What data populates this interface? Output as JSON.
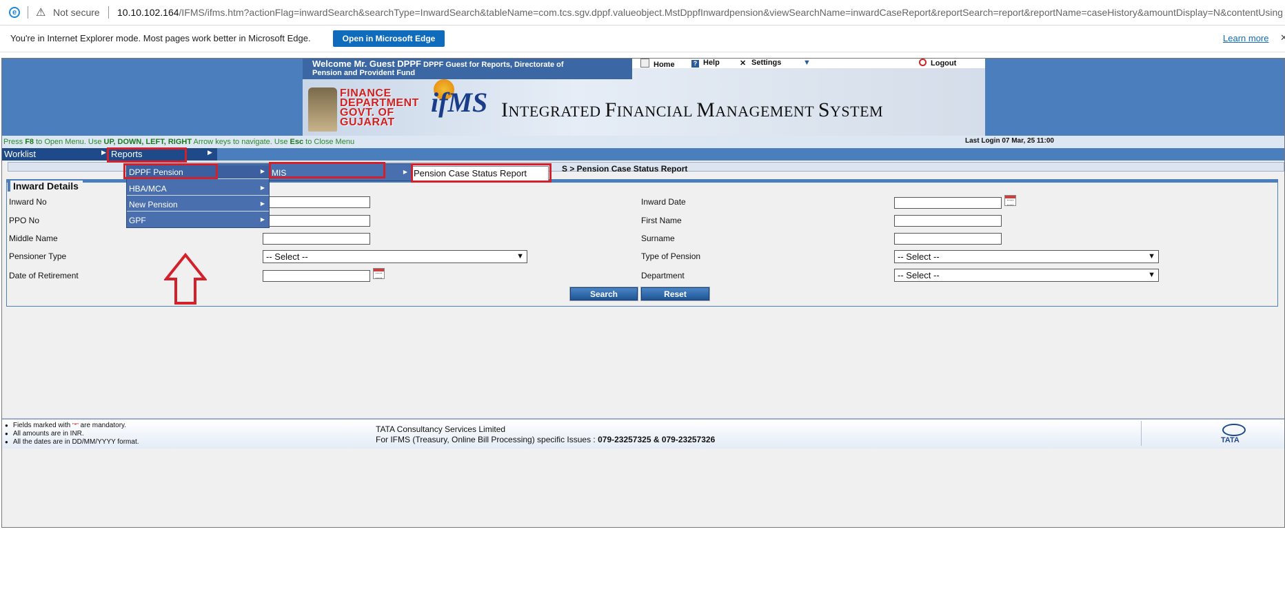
{
  "browser": {
    "security": "Not secure",
    "url_host": "10.10.102.164",
    "url_rest": "/IFMS/ifms.htm?actionFlag=inwardSearch&searchType=InwardSearch&tableName=com.tcs.sgv.dppf.valueobject.MstDppfInwardpension&viewSearchName=inwardCaseReport&reportSearch=report&reportName=caseHistory&amountDisplay=N&contentUsingA",
    "ie_message": "You're in Internet Explorer mode. Most pages work better in Microsoft Edge.",
    "open_edge": "Open in Microsoft Edge",
    "learn_more": "Learn more"
  },
  "header": {
    "welcome": "Welcome Mr. Guest  DPPF",
    "welcome_sub": "DPPF Guest for Reports, Directorate of",
    "welcome_sub2": "Pension and Provident Fund",
    "links": {
      "home": "Home",
      "help": "Help",
      "settings": "Settings",
      "logout": "Logout"
    },
    "dept": [
      "FINANCE",
      "DEPARTMENT",
      "GOVT. OF",
      "GUJARAT"
    ],
    "logo_text": "ifMS",
    "system_name_parts": [
      "I",
      "NTEGRATED ",
      "F",
      "INANCIAL ",
      "M",
      "ANAGEMENT ",
      "S",
      "YSTEM"
    ]
  },
  "hint": {
    "p1": "Press ",
    "k1": "F8",
    "p2": " to Open Menu. Use ",
    "k2": "UP, DOWN, LEFT, RIGHT",
    "p3": " Arrow keys to navigate. Use ",
    "k3": "Esc",
    "p4": " to Close Menu",
    "last_login": "Last Login 07 Mar, 25 11:00"
  },
  "menubar": {
    "worklist": "Worklist",
    "reports": "Reports"
  },
  "menus": {
    "reports_items": [
      "DPPF Pension",
      "HBA/MCA",
      "New Pension",
      "GPF"
    ],
    "dppf_items": [
      "MIS"
    ],
    "mis_items": [
      "Pension Case Status Report"
    ]
  },
  "breadcrumb": "S  > Pension Case Status Report",
  "form": {
    "title": "Inward Details",
    "inward_no": "Inward No",
    "inward_date": "Inward Date",
    "ppo_no": "PPO No",
    "first_name": "First Name",
    "middle_name": "Middle Name",
    "surname": "Surname",
    "pensioner_type": "Pensioner Type",
    "type_of_pension": "Type of Pension",
    "date_of_retirement": "Date of Retirement",
    "department": "Department",
    "select_placeholder": "-- Select --",
    "search": "Search",
    "reset": "Reset"
  },
  "footer": {
    "note1a": "Fields marked with ",
    "mandatory_mark": "\"*\"",
    "note1b": " are mandatory.",
    "note2": "All amounts are in INR.",
    "note3": "All the dates are in DD/MM/YYYY format.",
    "company": "TATA Consultancy Services Limited",
    "support": "For IFMS (Treasury, Online Bill Processing) specific Issues : ",
    "phones": "079-23257325 & 079-23257326",
    "brand": "TATA"
  },
  "colors": {
    "accent_blue": "#4a7ebd",
    "menu_blue": "#4a6fae",
    "highlight_red": "#d4202a",
    "hint_green": "#2a8a2a"
  }
}
